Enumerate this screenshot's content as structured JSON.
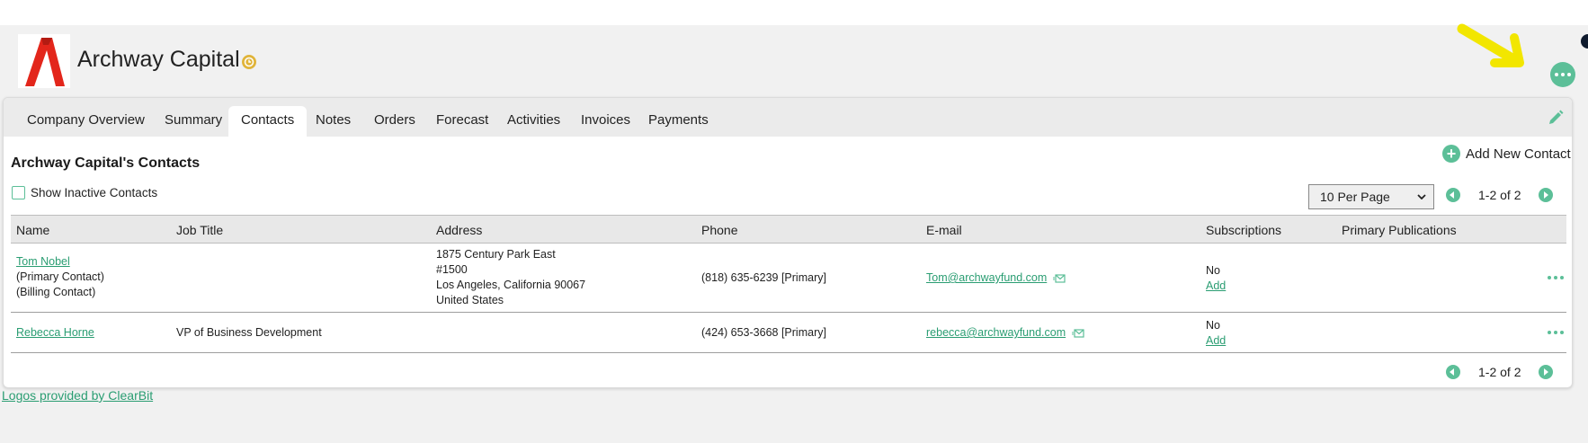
{
  "company": {
    "name": "Archway Capital"
  },
  "tabs": [
    {
      "label": "Company Overview"
    },
    {
      "label": "Summary"
    },
    {
      "label": "Contacts",
      "active": true
    },
    {
      "label": "Notes"
    },
    {
      "label": "Orders"
    },
    {
      "label": "Forecast"
    },
    {
      "label": "Activities"
    },
    {
      "label": "Invoices"
    },
    {
      "label": "Payments"
    }
  ],
  "contacts": {
    "title": "Archway Capital's Contacts",
    "add_label": "Add New Contact",
    "show_inactive_label": "Show Inactive Contacts",
    "per_page": "10 Per Page",
    "pagination": "1-2 of 2",
    "columns": [
      "Name",
      "Job Title",
      "Address",
      "Phone",
      "E-mail",
      "Subscriptions",
      "Primary Publications"
    ],
    "rows": [
      {
        "name": "Tom Nobel",
        "roles": [
          "(Primary Contact)",
          "(Billing Contact)"
        ],
        "job_title": "",
        "address": [
          "1875 Century Park East",
          "#1500",
          "Los Angeles, California 90067",
          "United States"
        ],
        "phone": "(818) 635-6239 [Primary]",
        "email": "Tom@archwayfund.com",
        "subscriptions": "No",
        "subscriptions_add": "Add",
        "primary_publications": ""
      },
      {
        "name": "Rebecca Horne",
        "roles": [],
        "job_title": "VP of Business Development",
        "address": [],
        "phone": "(424) 653-3668 [Primary]",
        "email": "rebecca@archwayfund.com",
        "subscriptions": "No",
        "subscriptions_add": "Add",
        "primary_publications": ""
      }
    ]
  },
  "footer": {
    "logos_credit": "Logos provided by ClearBit"
  },
  "colors": {
    "accent": "#5cbf98",
    "link": "#2a9d72",
    "annotation_arrow": "#f2e600",
    "logo_red": "#e3261b"
  },
  "icons": {
    "badge": "clock-badge-icon",
    "page_menu": "more-horizontal-icon",
    "edit": "pencil-icon",
    "add": "plus-circle-icon",
    "email": "envelope-icon",
    "prev": "chevron-left-icon",
    "next": "chevron-right-icon",
    "select": "chevron-down-icon"
  }
}
